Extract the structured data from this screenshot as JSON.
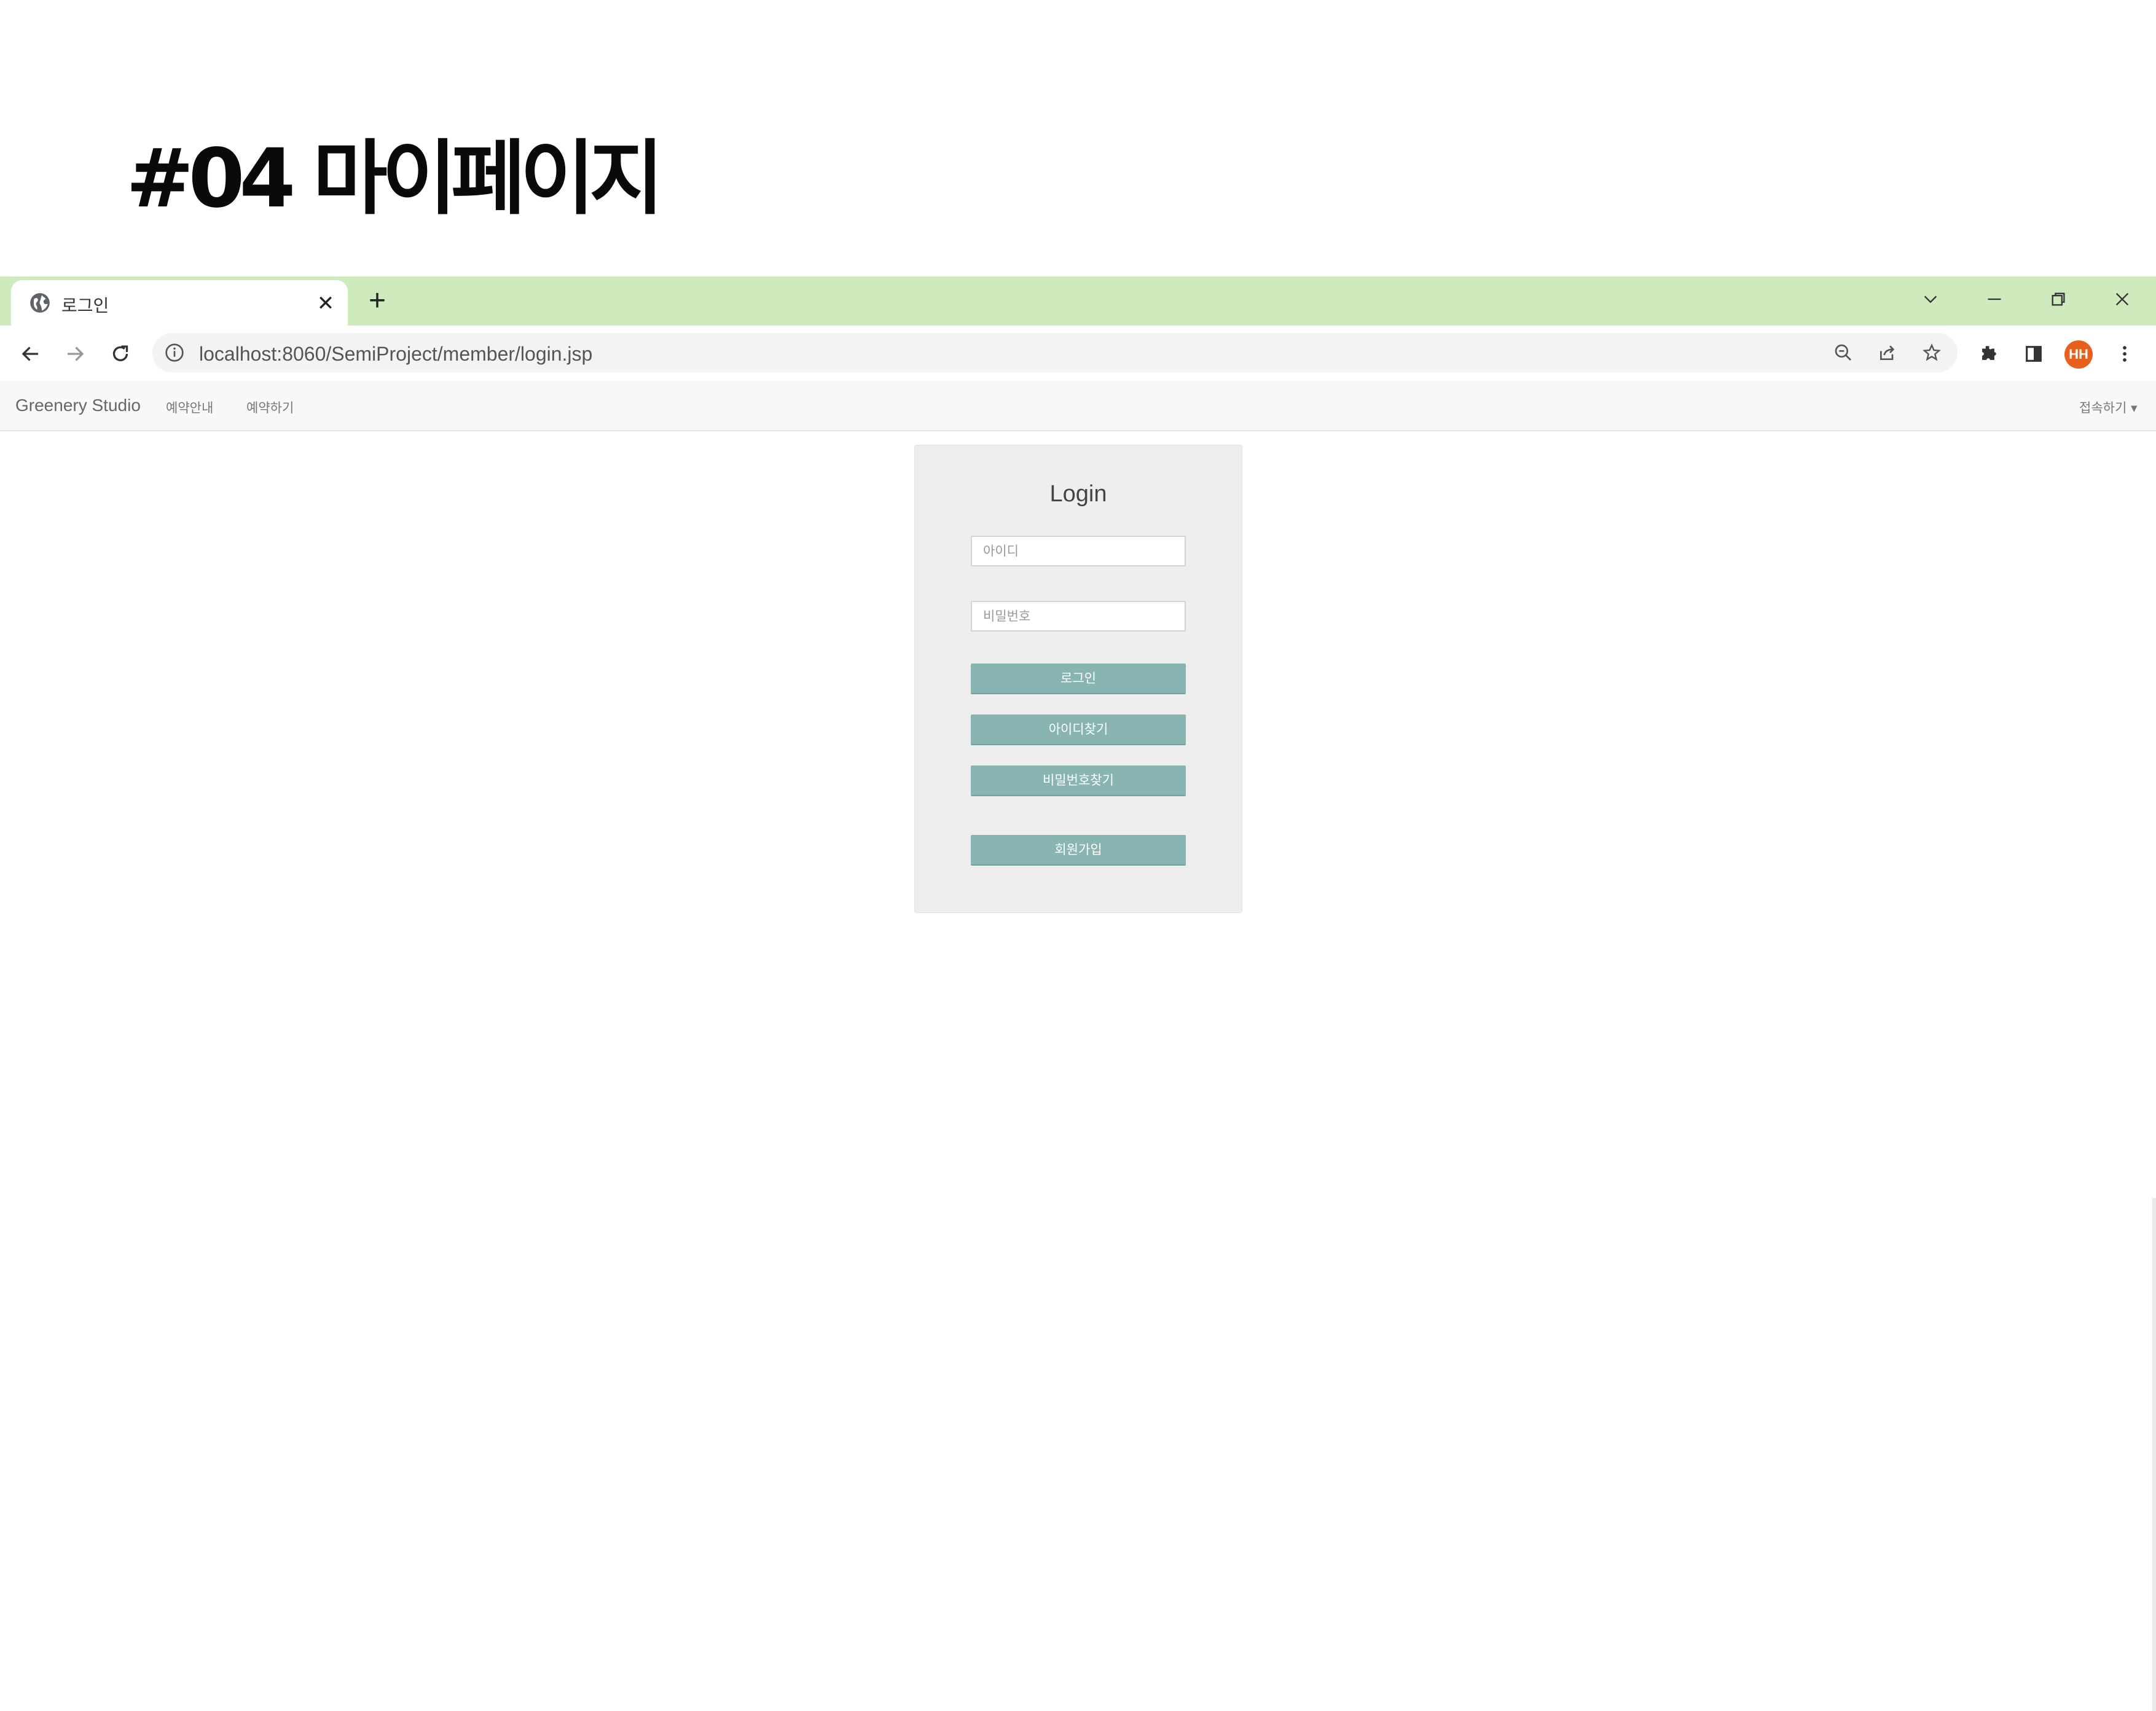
{
  "slide": {
    "title": "#04 마이페이지"
  },
  "browser": {
    "tab": {
      "title": "로그인",
      "icon": "globe-icon"
    },
    "window_controls": [
      "chevron-down-icon",
      "minimize-icon",
      "restore-icon",
      "close-icon"
    ],
    "omnibox": {
      "url": "localhost:8060/SemiProject/member/login.jsp"
    },
    "profile": {
      "initials": "HH",
      "color": "#e8601c"
    },
    "tabstrip_color": "#cfeabc"
  },
  "site": {
    "brand": "Greenery Studio",
    "nav": [
      "예약안내",
      "예약하기"
    ],
    "right_menu": "접속하기 ▾"
  },
  "login": {
    "title": "Login",
    "id_placeholder": "아이디",
    "pw_placeholder": "비밀번호",
    "login_button": "로그인",
    "find_id_button": "아이디찾기",
    "find_pw_button": "비밀번호찾기",
    "signup_button": "회원가입",
    "button_color": "#88b5b1"
  }
}
